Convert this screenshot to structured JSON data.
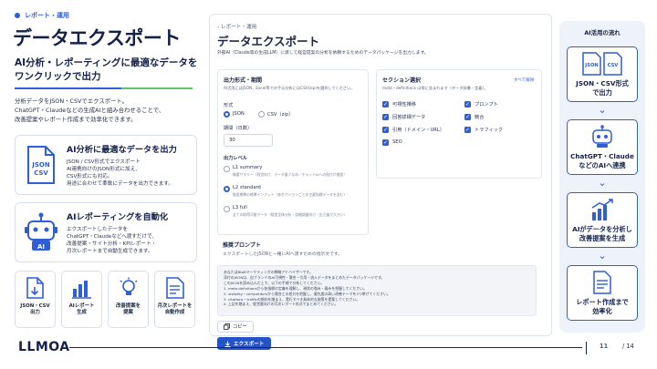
{
  "section_tag": "レポート・運用",
  "headline": "データエクスポート",
  "subheadline_line1": "AI分析・レポーティングに最適なデータを",
  "subheadline_line2": "ワンクリックで出力",
  "description": [
    "分析データをJSON・CSVでエクスポート。",
    "ChatGPT・Claudeなどの生成AIと組み合わせることで、",
    "改善提案やレポート作成まで効率化できます。"
  ],
  "cards": [
    {
      "title": "AI分析に最適なデータを出力",
      "lines": [
        "JSON / CSV形式でエクスポート",
        "AI連携向けのJSON形式に加え、",
        "CSV形式にも対応。",
        "用途に合わせて柔軟にデータを出力できます。"
      ],
      "icon_text": [
        "JSON",
        "CSV"
      ]
    },
    {
      "title": "AIレポーティングを自動化",
      "lines": [
        "エクスポートしたデータを",
        "ChatGPT・Claudeなどへ渡すだけで、",
        "改善提案・サイト分析・KPIレポート・",
        "月次レポートまで自動生成できます。"
      ],
      "icon_text": [
        "AI"
      ]
    }
  ],
  "mini_tiles": [
    {
      "label": "JSON・CSV\n出力",
      "icon": "file-export-icon"
    },
    {
      "label": "AIレポート\n生成",
      "icon": "bar-chart-icon"
    },
    {
      "label": "改善提案を\n提案",
      "icon": "lightbulb-icon"
    },
    {
      "label": "月次レポートを\n自動作成",
      "icon": "calendar-report-icon"
    }
  ],
  "app": {
    "breadcrumb": "‹ レポート・運用",
    "title": "データエクスポート",
    "description": "外部AI（Claude等の生成LLM）に渡して経営提案の分析を依頼するためのデータパッケージを出力します。",
    "format_panel": {
      "title": "出力形式・期間",
      "note": "AI活用にはJSON、Excel等での手元分析にはCSV(zip)を選択してください。",
      "format_label": "形式",
      "format_options": [
        "JSON",
        "CSV（zip）"
      ],
      "period_label": "期間（日数）",
      "period_value": "30",
      "level_label": "出力レベル",
      "levels": [
        {
          "name": "L1 summary",
          "note": "概要サマリー（経営向け、データ量少なめ／チャットAIへの貼付け推奨）"
        },
        {
          "name": "L2 standard",
          "note": "推奨標準の標準インプット（各セクションごとの主要指標データを含む）"
        },
        {
          "name": "L3 full",
          "note": "全ての取得可能データ（経営全体分析・詳細調査向け／出力量が大きい）"
        }
      ]
    },
    "section_panel": {
      "title": "セクション選択",
      "select_all": "すべて解除",
      "note": "meta・definitions は常に含まれます（データ辞書・定義）。",
      "items": [
        "可視性推移",
        "プロンプト",
        "回答詳細データ",
        "競合",
        "引用（ドメイン・URL）",
        "トラフィック",
        "SEO"
      ]
    },
    "prompt_panel": {
      "title": "推奨プロンプト",
      "note": "エクスポートしたJSONと一緒にAIへ渡すための指示文です。",
      "lines": [
        "あなたはBtoBマーケティングの戦略アドバイザーです。",
        "添付のJSONは、自ブランドのAI可視性・競合・引用・流入データをまとめたデータパッケージです。",
        "",
        "このJSONを読み込んだ上で、以下の手順で分析してください。",
        "1. meta.definitionsから各指標の定義を理解し、現状の強み・弱みを把握してください。",
        "2. visibility・competitorsから競合との差分を把握し、優先度の高い改善テーマを3つ挙げてください。",
        "3. citations・trafficの傾向を踏まえ、実行すべき具体的な施策を提案してください。",
        "4. 上記を踏まえ、経営層向けの月次レポート形式でまとめてください。"
      ],
      "copy_label": "コピー"
    },
    "export_label": "エクスポート"
  },
  "flow": {
    "title": "AI活用の流れ",
    "steps": [
      {
        "label": "JSON・CSV形式\nで出力",
        "icon": "json-csv-icon"
      },
      {
        "label": "ChatGPT・Claude\nなどのAIへ連携",
        "icon": "robot-icon"
      },
      {
        "label": "AIがデータを分析し\n改善提案を生成",
        "icon": "chart-up-icon"
      },
      {
        "label": "レポート作成まで\n効率化",
        "icon": "report-icon"
      }
    ]
  },
  "footer": {
    "logo": "LLMOA",
    "page_current": "11",
    "page_total": "/ 14"
  },
  "colors": {
    "brand_blue": "#2f5fd6",
    "navy": "#14224a",
    "accent_green": "#5fc46a"
  }
}
